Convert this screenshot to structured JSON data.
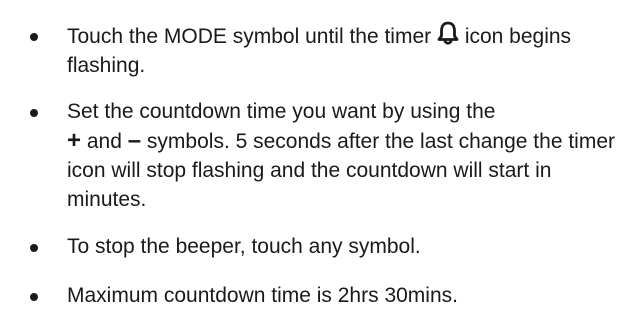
{
  "page": {
    "top_fragment": ""
  },
  "bullets": [
    {
      "part1": "Touch the MODE symbol until the timer ",
      "icon": "bell-icon",
      "part2": " icon begins flashing."
    },
    {
      "part1": "Set the countdown time you want by using the",
      "plus": "+",
      "and": " and ",
      "minus": "–",
      "part2": " symbols. 5 seconds after the last change the timer icon will stop flashing and the countdown will start in minutes."
    },
    {
      "text": "To stop the beeper, touch any symbol."
    },
    {
      "text": "Maximum countdown time is 2hrs 30mins."
    }
  ]
}
